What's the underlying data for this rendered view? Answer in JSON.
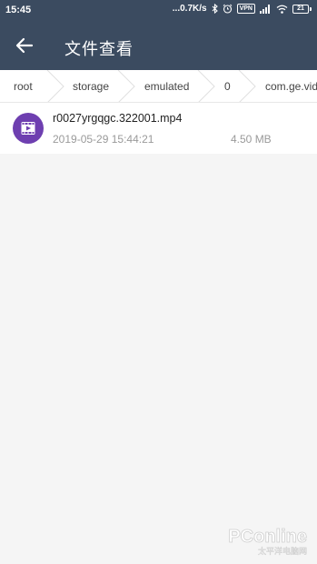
{
  "statusbar": {
    "time": "15:45",
    "network_speed": "...0.7K/s",
    "vpn": "VPN",
    "battery": "21"
  },
  "appbar": {
    "title": "文件查看"
  },
  "breadcrumb": [
    "root",
    "storage",
    "emulated",
    "0",
    "com.ge.vid"
  ],
  "files": [
    {
      "name": "r0027yrgqgc.322001.mp4",
      "date": "2019-05-29 15:44:21",
      "size": "4.50 MB",
      "icon": "video-file-icon"
    }
  ],
  "watermark": {
    "brand": "PConline",
    "tagline": "太平洋电脑网"
  },
  "colors": {
    "header": "#3b4b60",
    "background": "#f5f5f5",
    "file_icon": "#6e3fb0"
  }
}
